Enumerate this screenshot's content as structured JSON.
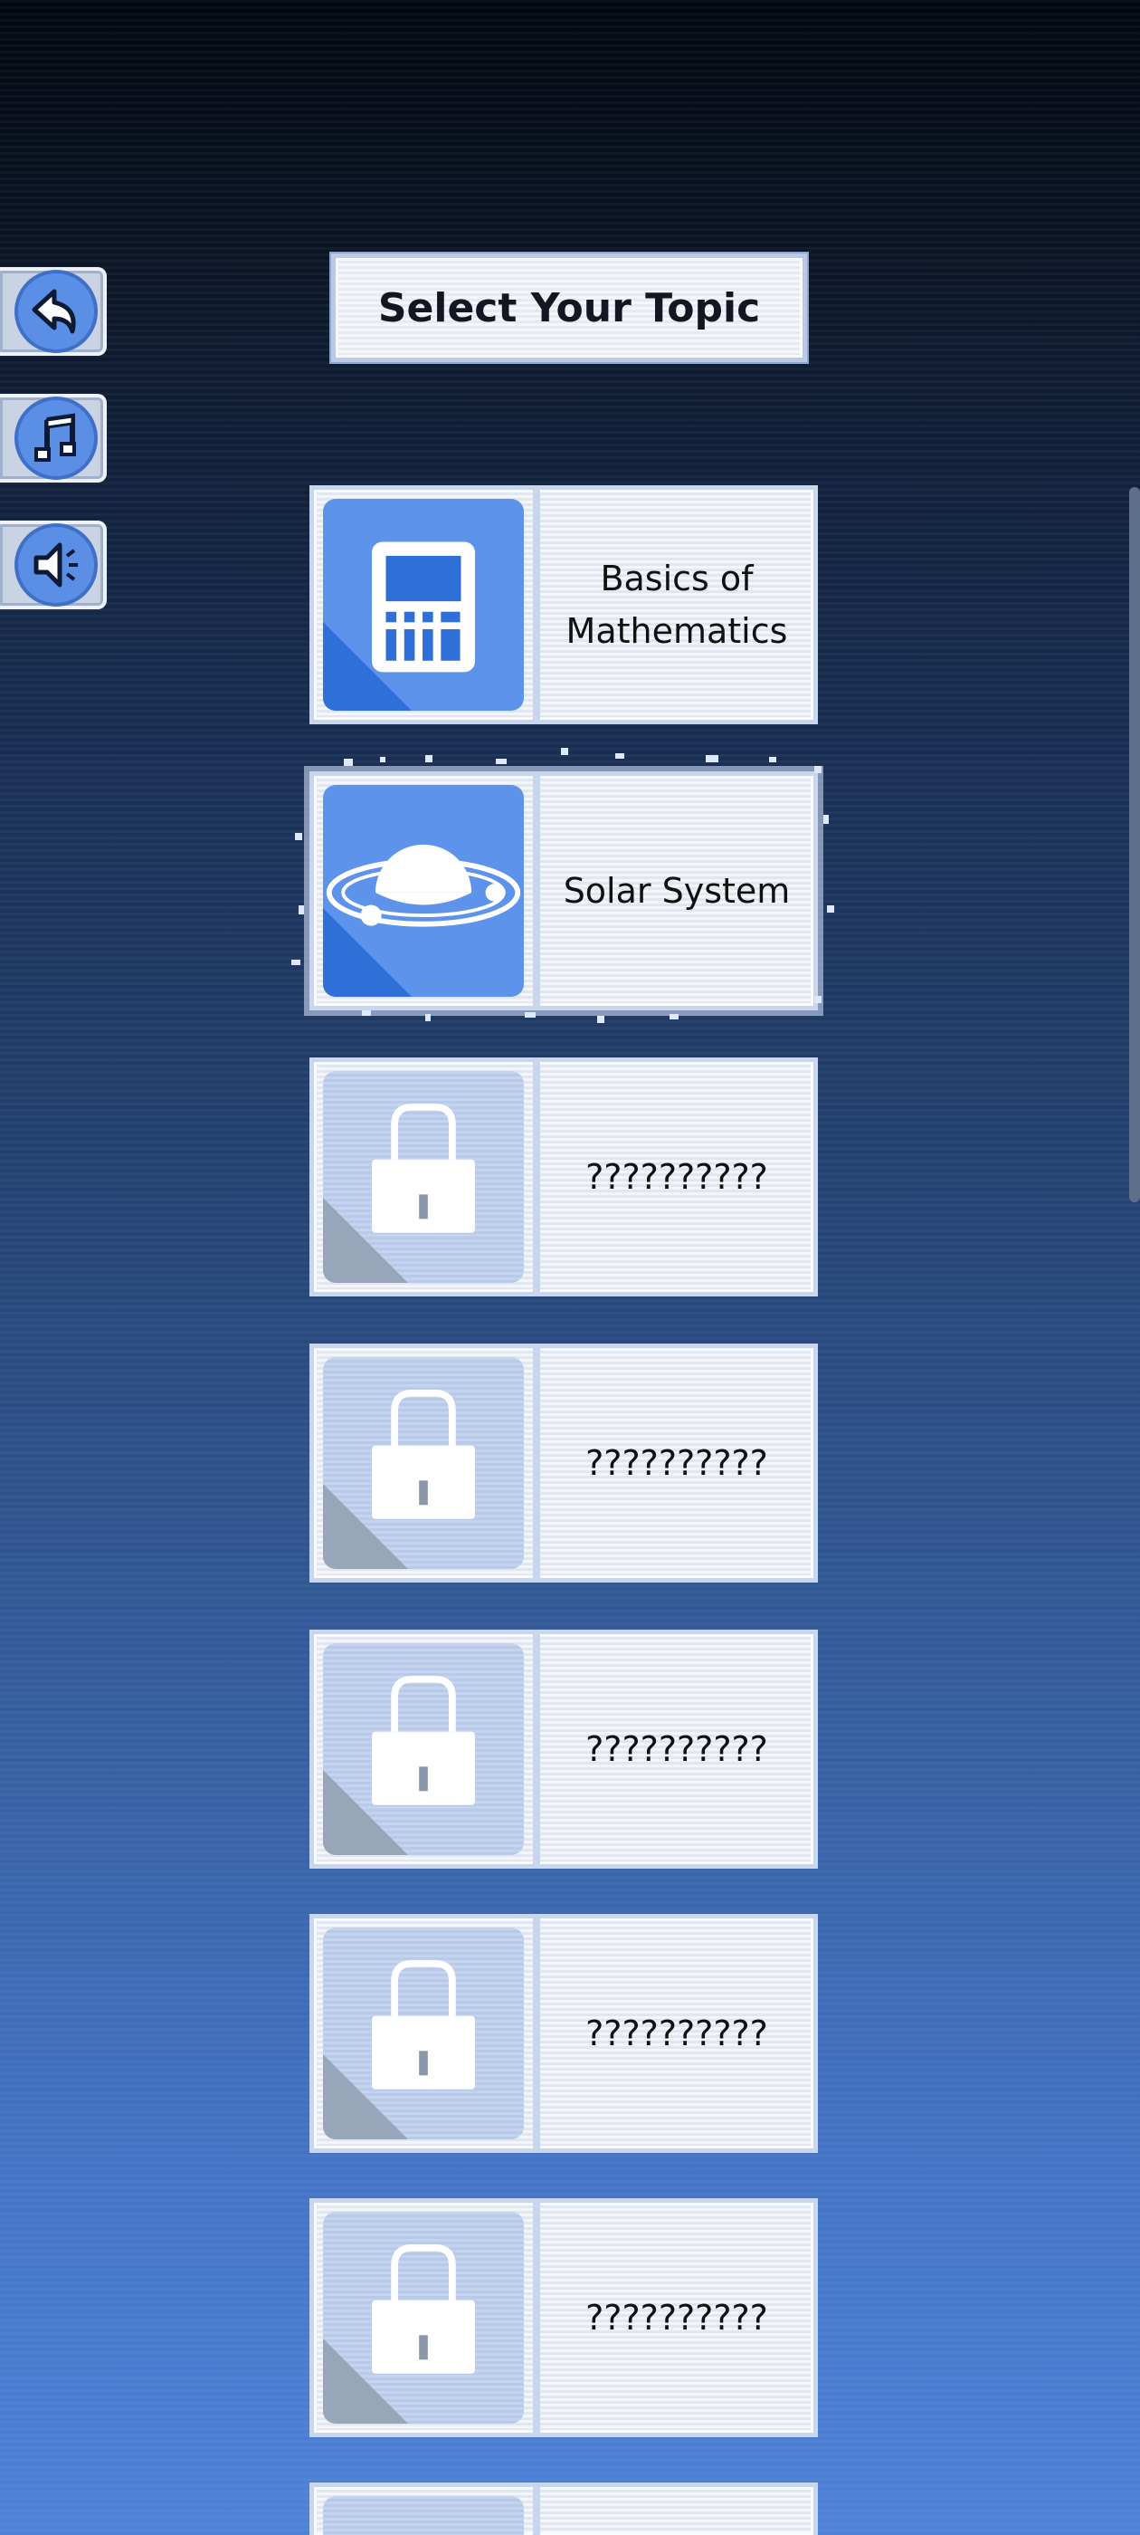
{
  "title": "Select Your Topic",
  "side_controls": [
    {
      "name": "back-button",
      "icon": "back-arrow-icon"
    },
    {
      "name": "music-button",
      "icon": "music-note-icon"
    },
    {
      "name": "sound-button",
      "icon": "speaker-icon"
    }
  ],
  "topics": [
    {
      "label_line1": "Basics of",
      "label_line2": "Mathematics",
      "icon": "calculator-icon",
      "locked": false
    },
    {
      "label_line1": "Solar System",
      "label_line2": "",
      "icon": "planet-icon",
      "locked": false,
      "selected": true
    },
    {
      "label_line1": "??????????",
      "label_line2": "",
      "icon": "lock-icon",
      "locked": true
    },
    {
      "label_line1": "??????????",
      "label_line2": "",
      "icon": "lock-icon",
      "locked": true
    },
    {
      "label_line1": "??????????",
      "label_line2": "",
      "icon": "lock-icon",
      "locked": true
    },
    {
      "label_line1": "??????????",
      "label_line2": "",
      "icon": "lock-icon",
      "locked": true
    },
    {
      "label_line1": "??????????",
      "label_line2": "",
      "icon": "lock-icon",
      "locked": true
    }
  ],
  "colors": {
    "accent_blue": "#5e93ec",
    "accent_dark_blue": "#2f6fd8",
    "locked_shadow": "#97a6b8"
  }
}
